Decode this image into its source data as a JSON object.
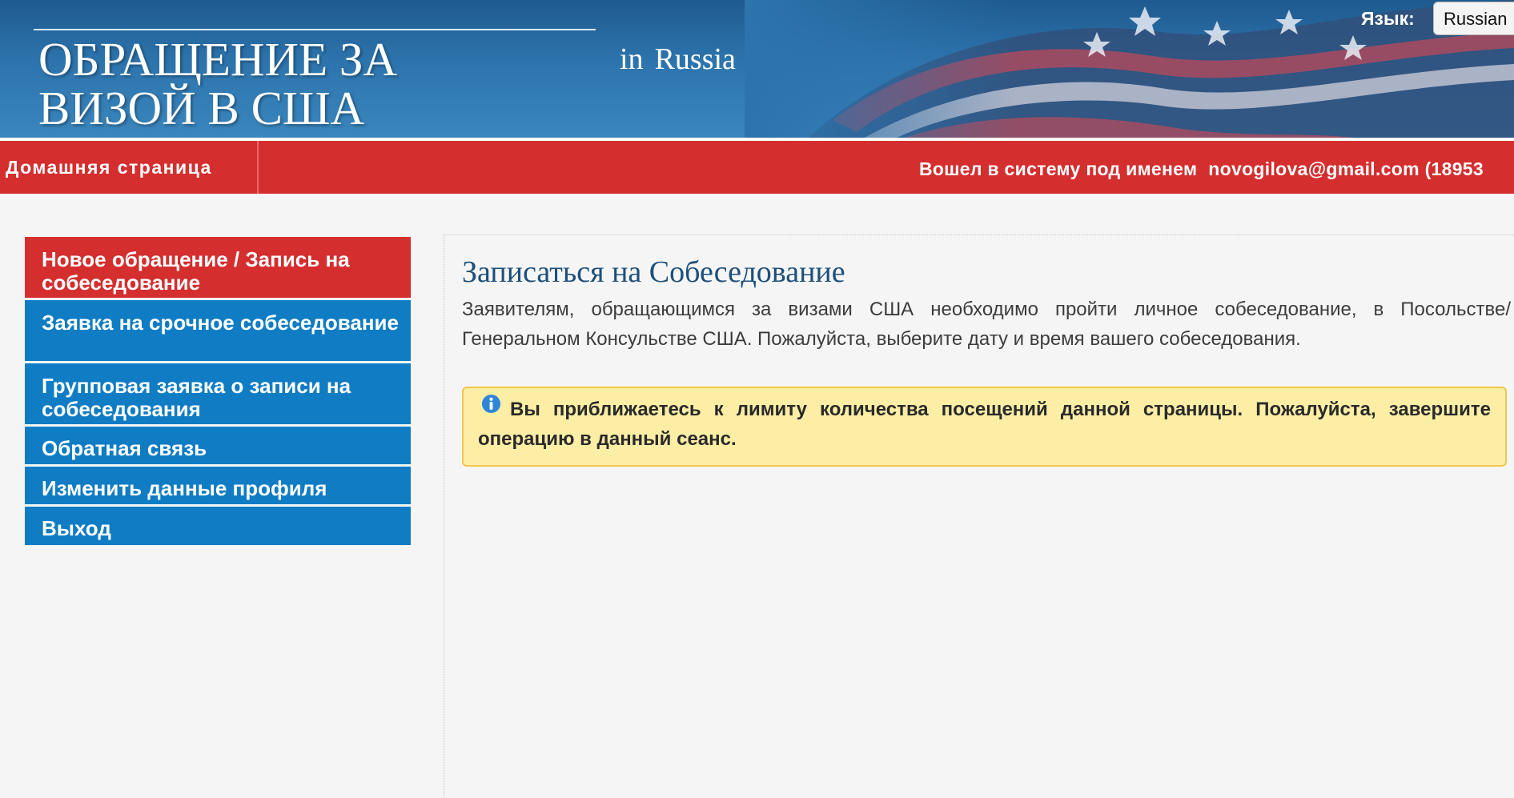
{
  "header": {
    "title": "ОБРАЩЕНИЕ ЗА ВИЗОЙ В США",
    "country_prefix": "in",
    "country": "Russia",
    "language_label": "Язык:",
    "language_selected": "Russian"
  },
  "navbar": {
    "home": "Домашняя страница",
    "logged_in_label": "Вошел в систему под именем",
    "user_email": "novogilova@gmail.com (18953"
  },
  "sidebar": {
    "items": [
      {
        "label": "Новое обращение / Запись на собеседование",
        "active": true
      },
      {
        "label": "Заявка на срочное собеседование",
        "active": false
      },
      {
        "label": "Групповая заявка о записи на собеседования",
        "active": false
      },
      {
        "label": "Обратная связь",
        "active": false
      },
      {
        "label": "Изменить данные профиля",
        "active": false
      },
      {
        "label": "Выход",
        "active": false
      }
    ]
  },
  "main": {
    "title": "Записаться на Собеседование",
    "intro": "Заявителям, обращающимся за визами США необходимо пройти личное собеседование, в Посольстве/ Генеральном Консульстве США. Пожалуйста, выберите дату и время вашего собеседования.",
    "alert": "Вы приближаетесь к лимиту количества посещений данной страницы. Пожалуйста, завершите операцию в данный сеанс."
  },
  "colors": {
    "banner_blue": "#2d74ad",
    "nav_red": "#d42e2e",
    "sidebar_blue": "#0f7cc4",
    "title_blue": "#1c4f7a",
    "alert_bg": "#fdeea6",
    "alert_border": "#f0c84a"
  },
  "icons": {
    "alert": "info-icon"
  }
}
